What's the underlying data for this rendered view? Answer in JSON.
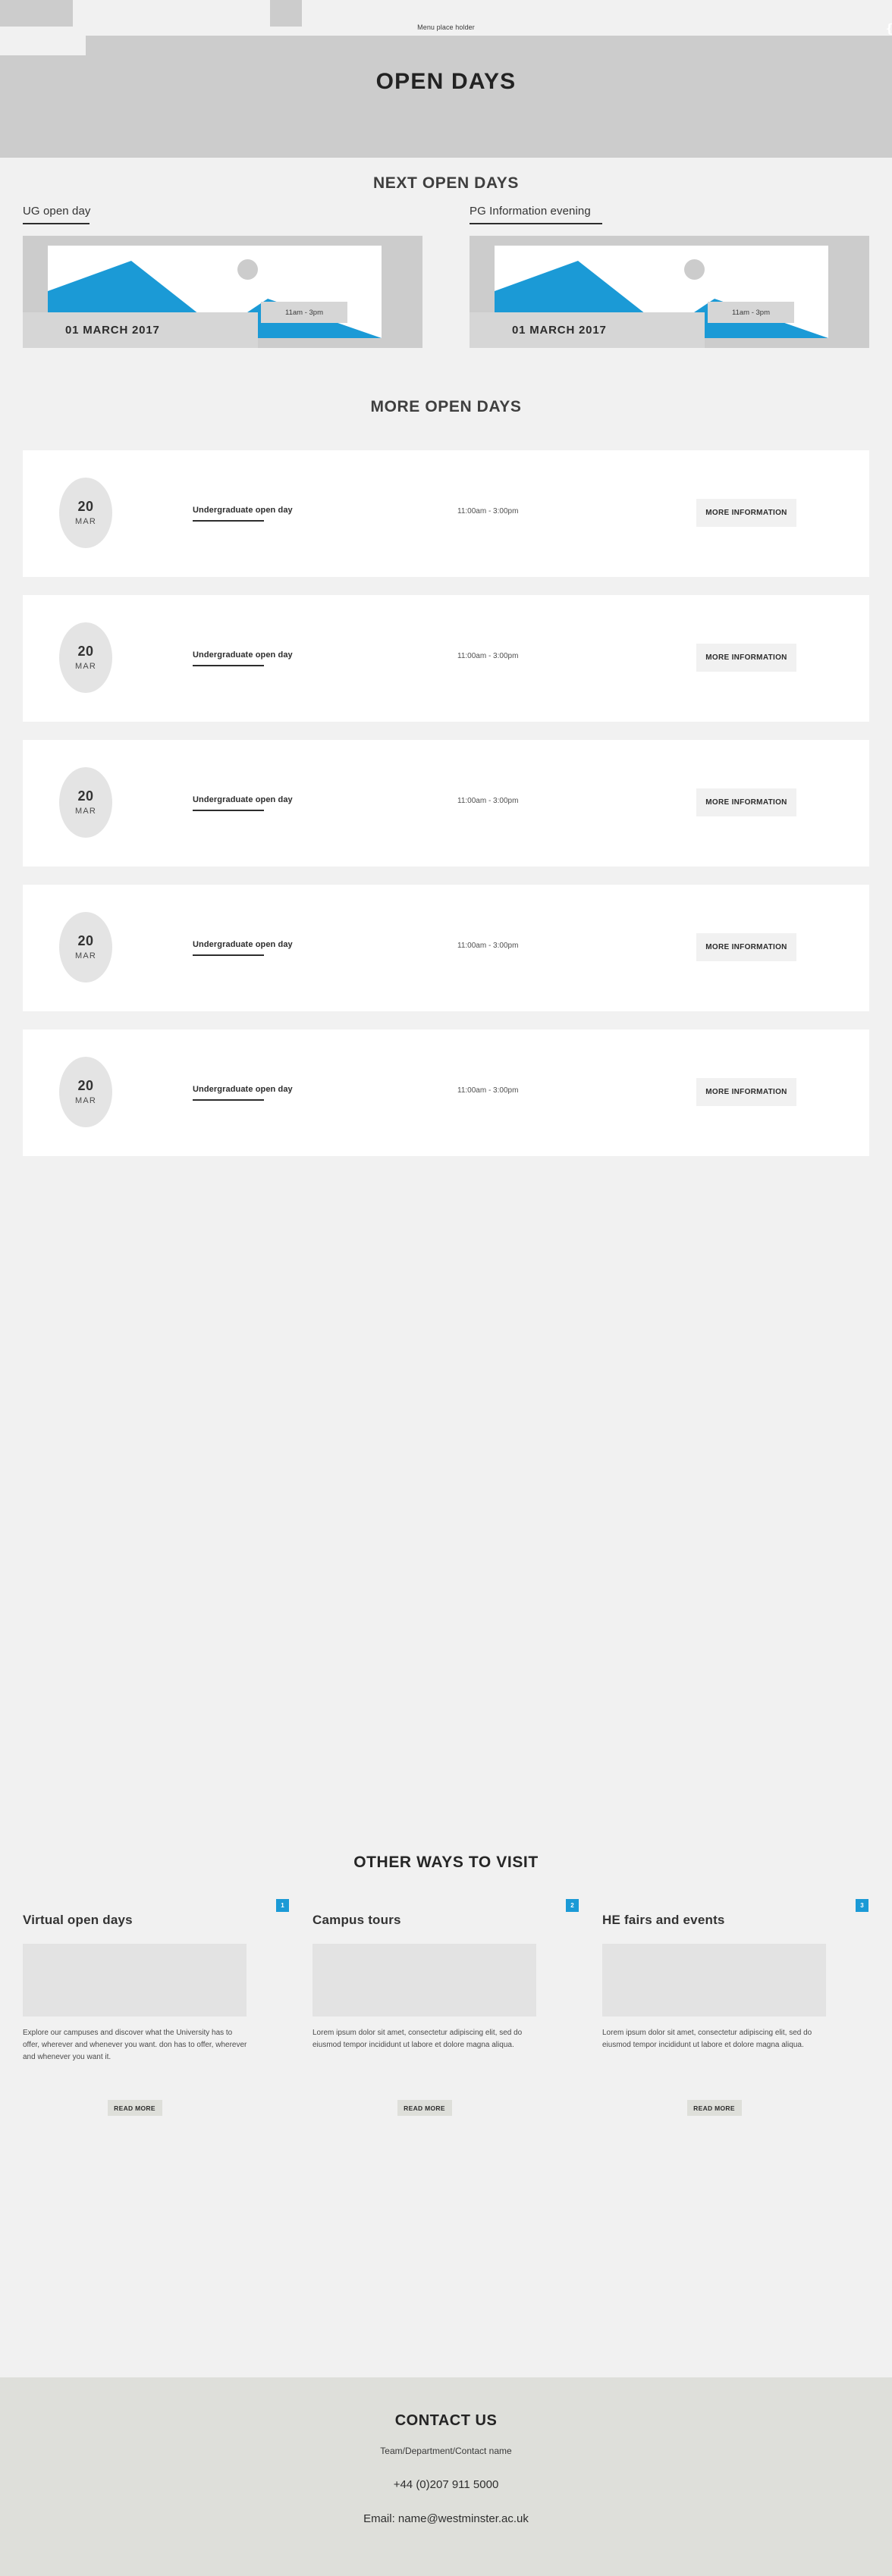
{
  "topbar": {
    "menu_placeholder": "Menu place holder"
  },
  "hero": {
    "title": "OPEN DAYS"
  },
  "next_open_days": {
    "title": "NEXT OPEN DAYS",
    "cards": [
      {
        "heading": "UG open day",
        "date": "01 MARCH 2017",
        "time": "11am - 3pm"
      },
      {
        "heading": "PG Information evening",
        "date": "01 MARCH 2017",
        "time": "11am - 3pm"
      }
    ]
  },
  "more_open_days": {
    "title": "MORE OPEN DAYS",
    "rows": [
      {
        "day": "20",
        "month": "MAR",
        "name": "Undergraduate open day",
        "time": "11:00am - 3:00pm",
        "button": "MORE INFORMATION"
      },
      {
        "day": "20",
        "month": "MAR",
        "name": "Undergraduate open day",
        "time": "11:00am - 3:00pm",
        "button": "MORE INFORMATION"
      },
      {
        "day": "20",
        "month": "MAR",
        "name": "Undergraduate open day",
        "time": "11:00am - 3:00pm",
        "button": "MORE INFORMATION"
      },
      {
        "day": "20",
        "month": "MAR",
        "name": "Undergraduate open day",
        "time": "11:00am - 3:00pm",
        "button": "MORE INFORMATION"
      },
      {
        "day": "20",
        "month": "MAR",
        "name": "Undergraduate open day",
        "time": "11:00am - 3:00pm",
        "button": "MORE INFORMATION"
      }
    ]
  },
  "other_ways": {
    "title": "OTHER WAYS TO VISIT",
    "cards": [
      {
        "badge": "1",
        "heading": "Virtual open days",
        "body": "Explore our campuses and discover what the University has to offer, wherever and whenever you want. don has to offer, wherever and whenever you want it.",
        "cta": "READ MORE"
      },
      {
        "badge": "2",
        "heading": "Campus tours",
        "body": "Lorem ipsum dolor sit amet, consectetur adipiscing elit, sed do eiusmod tempor incididunt ut labore et dolore magna aliqua.",
        "cta": "READ MORE"
      },
      {
        "badge": "3",
        "heading": "HE fairs and events",
        "body": "Lorem ipsum dolor sit amet, consectetur adipiscing elit, sed do eiusmod tempor incididunt ut labore et dolore magna aliqua.",
        "cta": "READ MORE"
      }
    ]
  },
  "footer": {
    "title": "CONTACT US",
    "contact_name": "Team/Department/Contact name",
    "phone": "+44 (0)207 911 5000",
    "email": "Email: name@westminster.ac.uk"
  },
  "colors": {
    "accent_blue": "#1b9ad6",
    "page_bg": "#f1f1f1",
    "hero_bg": "#cccccc",
    "footer_bg": "#dedfda"
  }
}
